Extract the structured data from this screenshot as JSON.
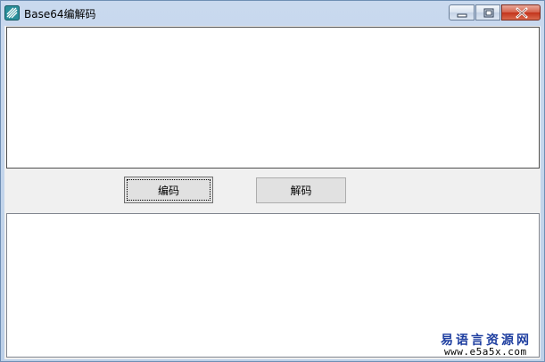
{
  "window": {
    "title": "Base64编解码",
    "icon": "app-logo-icon",
    "controls": {
      "minimize_icon": "minimize-icon",
      "maximize_icon": "maximize-icon",
      "close_icon": "close-icon"
    }
  },
  "main": {
    "input_text": "",
    "output_text": "",
    "encode_button_label": "编码",
    "decode_button_label": "解码"
  },
  "watermark": {
    "site_name": "易语言资源网",
    "site_url": "www.e5a5x.com"
  },
  "colors": {
    "title_bar": "#bcd0e8",
    "client_bg": "#f0f0f0",
    "close_button": "#c3341b",
    "watermark_text": "#1f3fa0"
  }
}
